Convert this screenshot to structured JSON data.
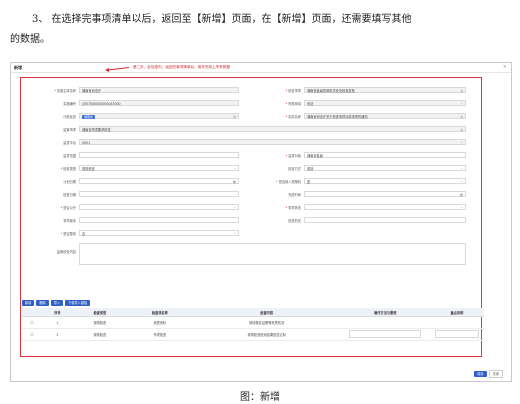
{
  "paragraph": {
    "line1": "3、 在选择完事项清单以后，返回至【新增】页面，在【新增】页面，还需要填写其他",
    "line2": "的数据。"
  },
  "dialog": {
    "title": "新增",
    "close": "×",
    "annotation": "第二步，此信息内，返回完事项清单后，填写完成上所有数据",
    "fields": {
      "subject_label": "实施主体名称",
      "subject_value": "湖南省司法厅",
      "check_code_label": "检查事项",
      "check_code_value": "湖南省各级党政机关安全检查复核",
      "code_label": "实施编号",
      "code_value": "4307000000000043000",
      "domain_label": "所属领域",
      "domain_value": "司法",
      "unit_label": "行政区划",
      "unit_value": "湖南省",
      "org_label": "实际名称",
      "org_value": "湖南省司法厅关于检查事项清单事项的通知",
      "basis_label": "监管事项",
      "basis_value": "湖南省事项要求检查",
      "platform_label": "监督平台",
      "platform_value": "0001",
      "scope_label": "监督范围",
      "scope_value": "",
      "target_label": "监督对象",
      "target_value": "湖南省各级",
      "method_label": "检查类型",
      "method_value": "现场检查",
      "way_label": "检查方式",
      "way_value": "现场",
      "plan_label": "计划日期",
      "plan_value": "",
      "join_label": "是否纳入双随机",
      "join_value": "是",
      "date_label": "检查日期",
      "date_value": "",
      "end_label": "完成时间",
      "end_value": "",
      "public_label": "是否公开",
      "public_value": "",
      "status_label": "事项状态",
      "status_value": "",
      "doc_label": "事项版本",
      "doc_value": "",
      "dept_label": "检查机关",
      "dept_value": "",
      "rect_label": "是否整改",
      "rect_value": "否",
      "remark_label": "监管检查内容",
      "remark_value": ""
    },
    "org_pill": "湖南省",
    "toolbar": [
      "新增",
      "删除",
      "导入",
      "下载导入模板"
    ],
    "table": {
      "headers": [
        "序号",
        "检查类型",
        "检查项名称",
        "检查内容",
        "操作方法与要领",
        "重点说明"
      ],
      "rows": [
        {
          "no": "1",
          "type": "现场检查",
          "name": "资质资料",
          "content": "现场核实证照等资质情况",
          "method": "",
          "note": ""
        },
        {
          "no": "2",
          "type": "现场检查",
          "name": "专项检查",
          "content": "现场检查检测结果是否达标",
          "method": "",
          "note": ""
        }
      ]
    },
    "footer": {
      "save": "保存",
      "close": "关闭"
    }
  },
  "caption": "图：新增"
}
